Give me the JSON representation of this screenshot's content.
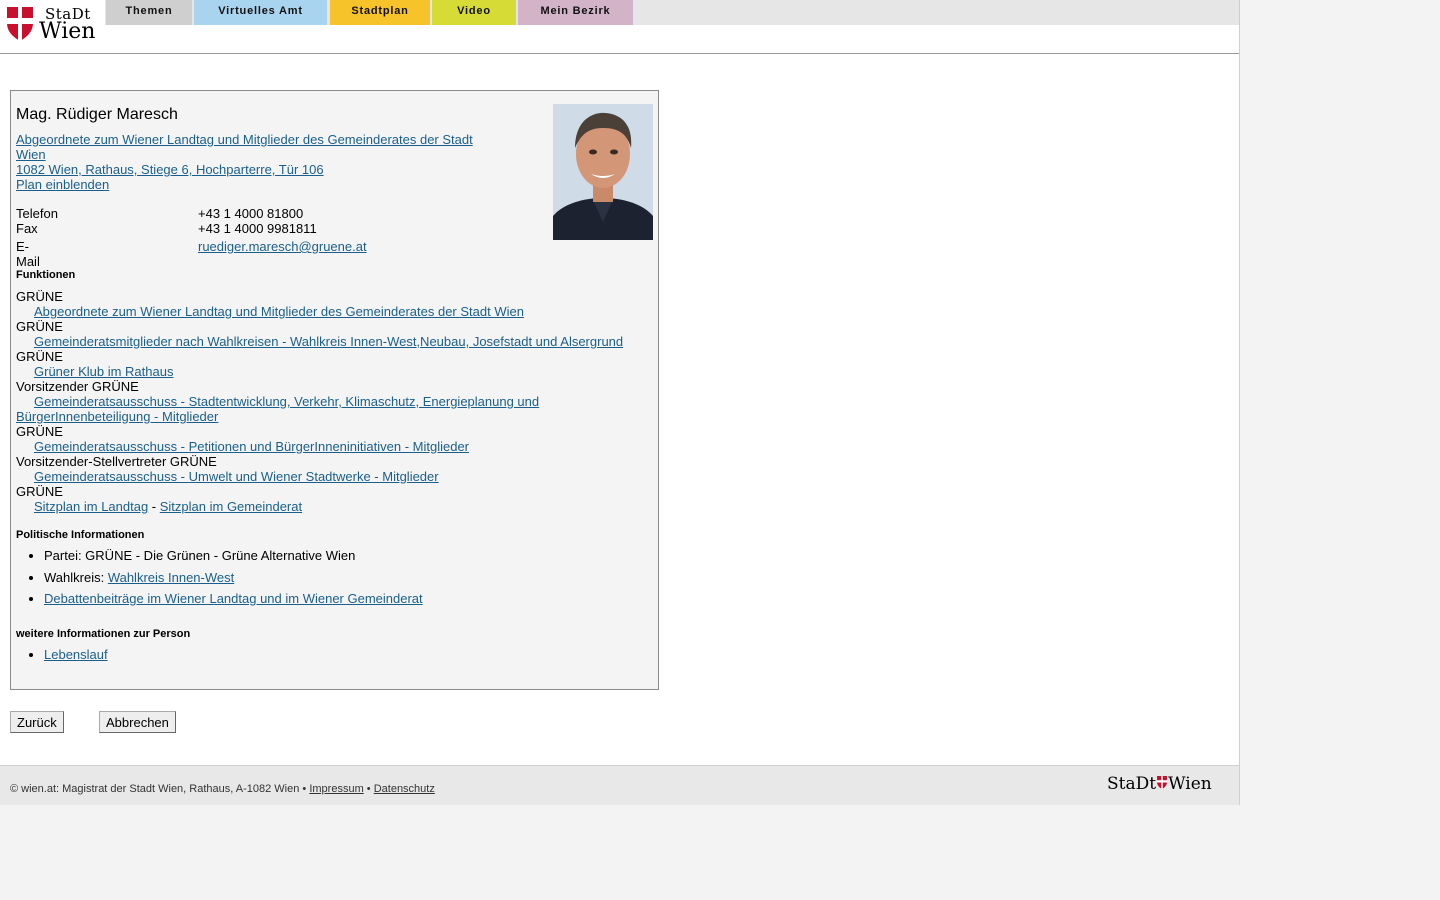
{
  "logo": {
    "stadt": "StaDt",
    "wien": "Wien"
  },
  "nav": {
    "tabs": [
      {
        "label": "Themen",
        "color": "#cfcfcf"
      },
      {
        "label": "Virtuelles Amt",
        "color": "#a9d4ef"
      },
      {
        "label": "Stadtplan",
        "color": "#f6c42a"
      },
      {
        "label": "Video",
        "color": "#d6dc35"
      },
      {
        "label": "Mein Bezirk",
        "color": "#d3b3c8"
      }
    ]
  },
  "person": {
    "name": "Mag. Rüdiger Maresch",
    "role_link_line1": "Abgeordnete zum Wiener Landtag und Mitglieder des Gemeinderates der Stadt",
    "role_link_line2": "Wien ",
    "address": "1082 Wien, Rathaus, Stiege 6, Hochparterre, Tür 106",
    "plan_link": "Plan einblenden",
    "phone_label": "Telefon",
    "phone": "+43 1 4000 81800",
    "fax_label": "Fax",
    "fax": "+43 1 4000 9981811",
    "email_label": "E-Mail",
    "email": "ruediger.maresch@gruene.at"
  },
  "functions": {
    "heading": "Funktionen",
    "items": [
      {
        "role": "GRÜNE",
        "link": "Abgeordnete zum Wiener Landtag und Mitglieder des Gemeinderates der Stadt Wien"
      },
      {
        "role": "GRÜNE",
        "link": "Gemeinderatsmitglieder nach Wahlkreisen - Wahlkreis Innen-West,Neubau, Josefstadt und Alsergrund"
      },
      {
        "role": "GRÜNE",
        "link": "Grüner Klub im Rathaus"
      },
      {
        "role": "Vorsitzender GRÜNE",
        "link": "Gemeinderatsausschuss - Stadtentwicklung, Verkehr, Klimaschutz, Energieplanung und",
        "link_cont": "BürgerInnenbeteiligung - Mitglieder"
      },
      {
        "role": "GRÜNE",
        "link": "Gemeinderatsausschuss - Petitionen und BürgerInneninitiativen - Mitglieder"
      },
      {
        "role": "Vorsitzender-Stellvertreter GRÜNE",
        "link": "Gemeinderatsausschuss - Umwelt und Wiener Stadtwerke - Mitglieder"
      },
      {
        "role": "GRÜNE"
      }
    ],
    "sitzplan_landtag": "Sitzplan im Landtag",
    "sitzplan_sep": " - ",
    "sitzplan_gemeinderat": "Sitzplan im Gemeinderat"
  },
  "political": {
    "heading": "Politische Informationen",
    "partei": "Partei: GRÜNE - Die Grünen - Grüne Alternative Wien",
    "wahlkreis_label": "Wahlkreis: ",
    "wahlkreis_link": "Wahlkreis Innen-West",
    "debatten": "Debattenbeiträge im Wiener Landtag und im Wiener Gemeinderat"
  },
  "more": {
    "heading": "weitere Informationen zur Person",
    "lebenslauf": "Lebenslauf"
  },
  "buttons": {
    "back": "Zurück",
    "cancel": "Abbrechen"
  },
  "footer": {
    "text": "© wien.at: Magistrat der Stadt Wien, Rathaus, A-1082 Wien • ",
    "impressum": "Impressum",
    "sep": " • ",
    "datenschutz": "Datenschutz",
    "logo_stadt": "StaDt",
    "logo_wien": "Wien"
  }
}
